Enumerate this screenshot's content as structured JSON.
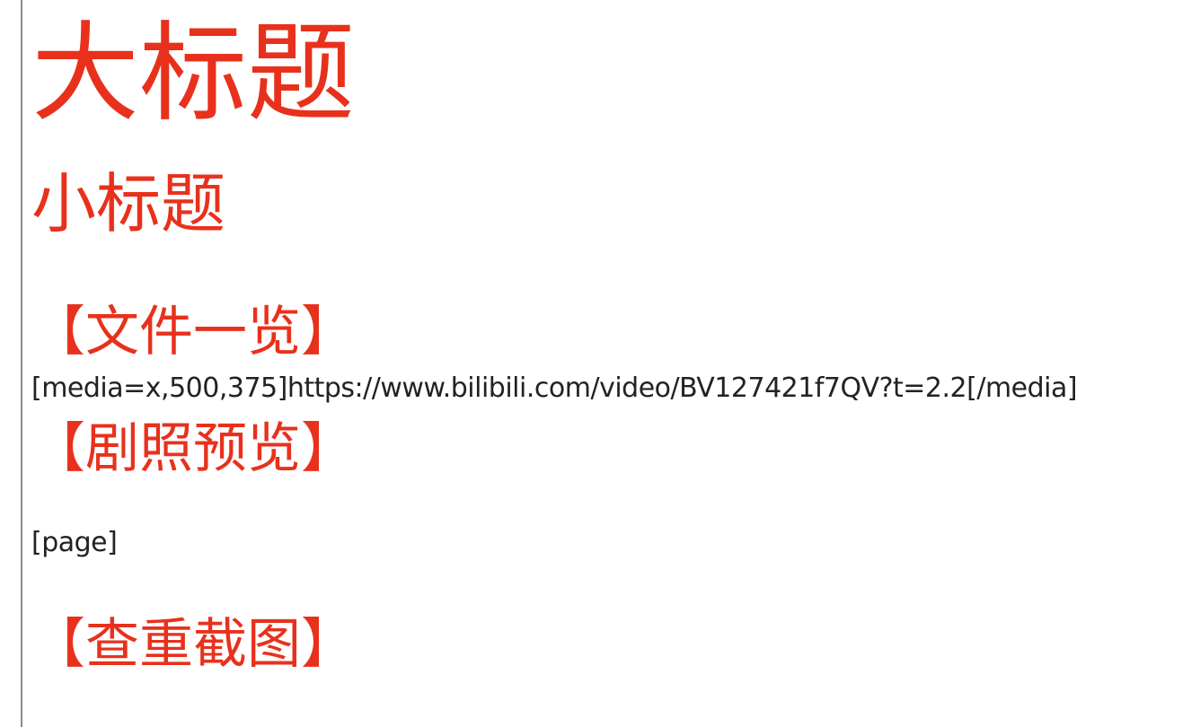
{
  "theme": {
    "heading_color": "#e8311c",
    "text_color": "#222222",
    "rule_color": "#8a8a8a"
  },
  "document": {
    "big_title": "大标题",
    "sub_title": "小标题",
    "sections": [
      {
        "heading": "【文件一览】",
        "body": "[media=x,500,375]https://www.bilibili.com/video/BV127421f7QV?t=2.2[/media]"
      },
      {
        "heading": "【剧照预览】",
        "body": "[page]"
      },
      {
        "heading": "【查重截图】"
      }
    ]
  }
}
